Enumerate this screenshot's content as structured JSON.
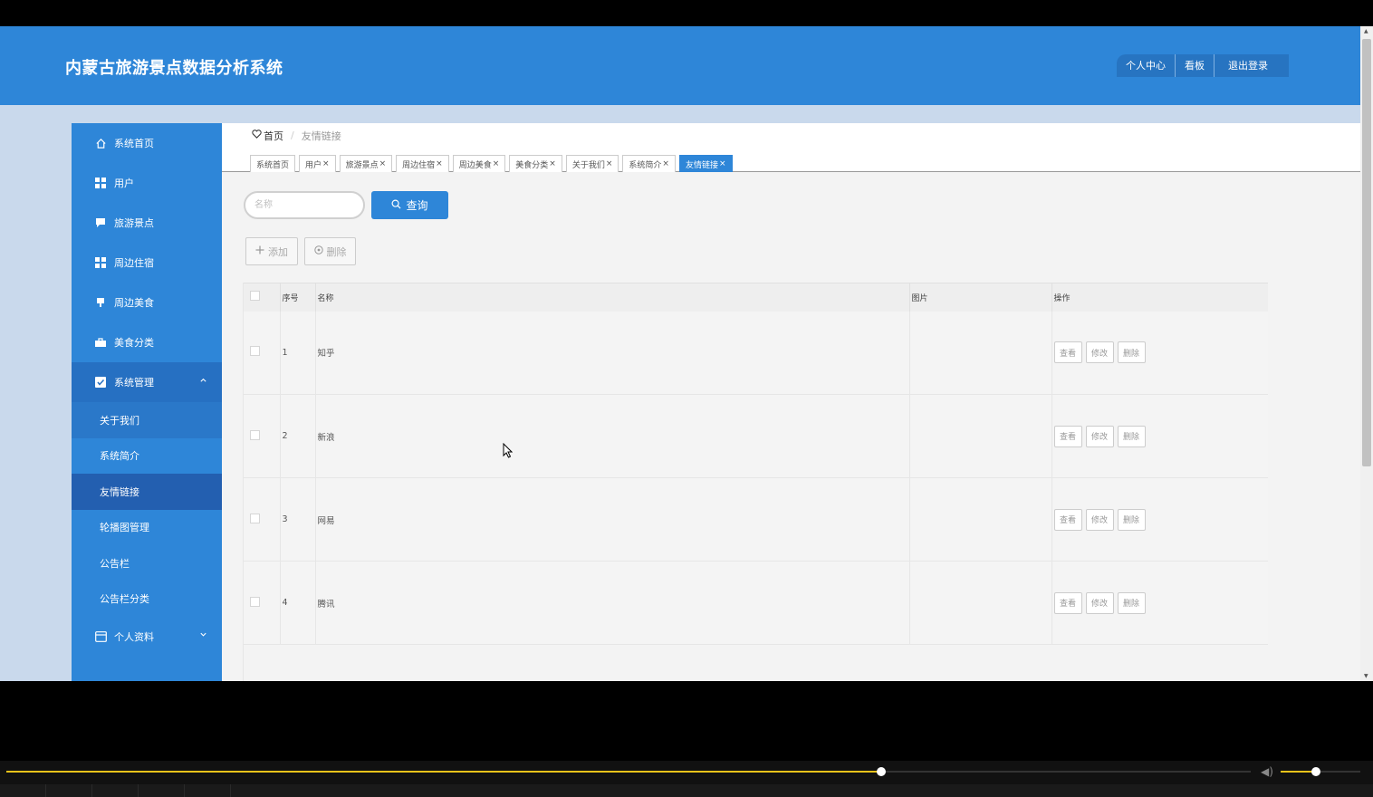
{
  "header": {
    "title": "内蒙古旅游景点数据分析系统",
    "actions": [
      "个人中心",
      "看板",
      "退出登录"
    ]
  },
  "sidebar": {
    "items": [
      {
        "label": "系统首页",
        "icon": "home-icon"
      },
      {
        "label": "用户",
        "icon": "grid-icon"
      },
      {
        "label": "旅游景点",
        "icon": "chat-icon"
      },
      {
        "label": "周边住宿",
        "icon": "grid-icon"
      },
      {
        "label": "周边美食",
        "icon": "cup-icon"
      },
      {
        "label": "美食分类",
        "icon": "suitcase-icon"
      },
      {
        "label": "系统管理",
        "icon": "check-icon"
      },
      {
        "label": "个人资料",
        "icon": "card-icon"
      }
    ],
    "sub_items": [
      "关于我们",
      "系统简介",
      "友情链接",
      "轮播图管理",
      "公告栏",
      "公告栏分类"
    ]
  },
  "breadcrumb": {
    "home": "首页",
    "separator": "/",
    "current": "友情链接"
  },
  "tabs": [
    {
      "label": "系统首页",
      "closable": false
    },
    {
      "label": "用户",
      "closable": true
    },
    {
      "label": "旅游景点",
      "closable": true
    },
    {
      "label": "周边住宿",
      "closable": true
    },
    {
      "label": "周边美食",
      "closable": true
    },
    {
      "label": "美食分类",
      "closable": true
    },
    {
      "label": "关于我们",
      "closable": true
    },
    {
      "label": "系统简介",
      "closable": true
    },
    {
      "label": "友情链接",
      "closable": true,
      "active": true
    }
  ],
  "tab_close": "×",
  "search": {
    "placeholder": "名称",
    "button": "查询"
  },
  "toolbar": {
    "add": "添加",
    "delete": "删除"
  },
  "table": {
    "headers": [
      "",
      "序号",
      "名称",
      "图片",
      "操作"
    ],
    "rows": [
      {
        "index": "1",
        "name": "知乎"
      },
      {
        "index": "2",
        "name": "新浪"
      },
      {
        "index": "3",
        "name": "网易"
      },
      {
        "index": "4",
        "name": "腾讯"
      }
    ],
    "row_actions": [
      "查看",
      "修改",
      "删除"
    ]
  },
  "player": {
    "progress": 0.703,
    "volume": 0.44
  },
  "colors": {
    "primary": "#2e86d8",
    "sidebar_active": "#235fb0",
    "progress": "#e8c21a"
  }
}
